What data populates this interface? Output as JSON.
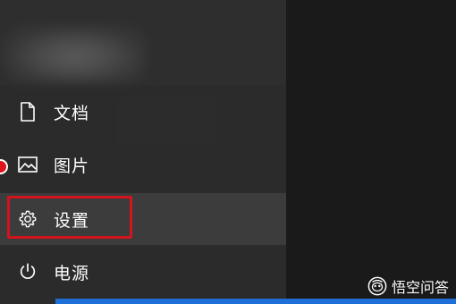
{
  "menu": {
    "items": [
      {
        "label": "文档",
        "icon": "document-icon"
      },
      {
        "label": "图片",
        "icon": "pictures-icon"
      },
      {
        "label": "设置",
        "icon": "gear-icon"
      },
      {
        "label": "电源",
        "icon": "power-icon"
      }
    ],
    "active_item": "设置"
  },
  "watermark": {
    "text": "悟空问答"
  },
  "colors": {
    "menu_bg": "#2b2b2b",
    "active_bg": "#3c3c3c",
    "highlight": "#d4141c",
    "accent_bar": "#1f6fd8"
  }
}
